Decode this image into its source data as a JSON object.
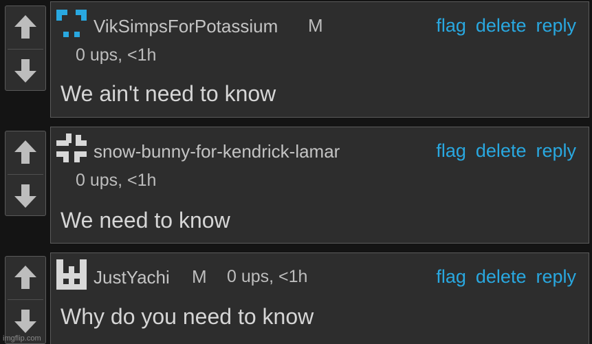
{
  "comments": [
    {
      "username": "VikSimpsForPotassium",
      "mod_badge": "M",
      "meta": "0 ups, <1h",
      "text": "We ain't need to know",
      "avatar_color": "#29a8e0",
      "actions": {
        "flag": "flag",
        "delete": "delete",
        "reply": "reply"
      }
    },
    {
      "username": "snow-bunny-for-kendrick-lamar",
      "mod_badge": "",
      "meta": "0 ups, <1h",
      "text": "We need to know",
      "avatar_color": "#d8d8d8",
      "actions": {
        "flag": "flag",
        "delete": "delete",
        "reply": "reply"
      }
    },
    {
      "username": "JustYachi",
      "mod_badge": "M",
      "meta": "0 ups, <1h",
      "text": "Why do you need to know",
      "avatar_color": "#d8d8d8",
      "actions": {
        "flag": "flag",
        "delete": "delete",
        "reply": "reply"
      }
    }
  ],
  "watermark": "imgflip.com",
  "colors": {
    "link": "#29a8e0",
    "background": "#141414",
    "card": "#2d2d2d"
  }
}
